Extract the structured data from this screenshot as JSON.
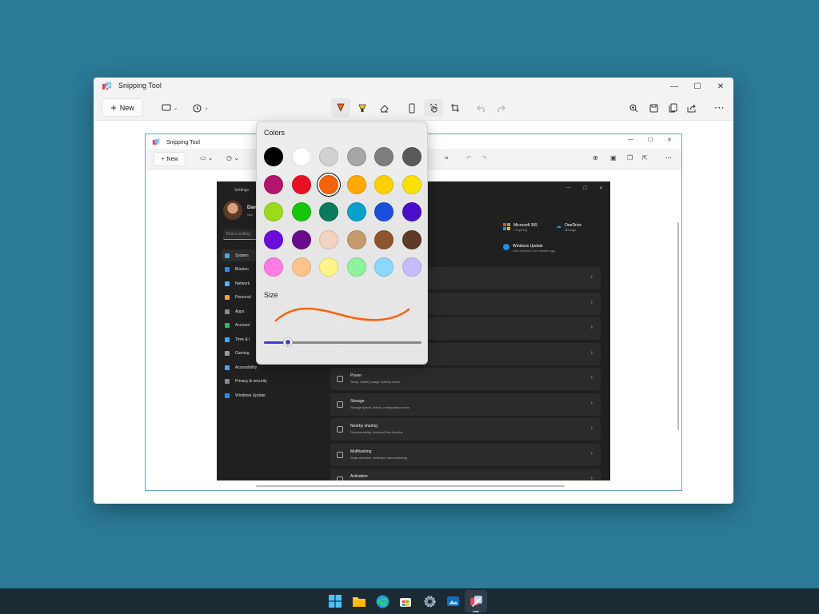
{
  "window": {
    "title": "Snipping Tool",
    "minimize": "—",
    "maximize": "☐",
    "close": "✕"
  },
  "toolbar": {
    "new_label": "New",
    "new_plus": "+",
    "more": "···"
  },
  "flyout": {
    "colors_label": "Colors",
    "size_label": "Size",
    "selected_color": "#f7630c",
    "pen_size_fraction": 0.15,
    "colors": [
      "#000000",
      "#ffffff",
      "#d1d1d1",
      "#a6a6a6",
      "#7e7e7e",
      "#5a5a5a",
      "#b4146c",
      "#e81123",
      "#f7630c",
      "#ffaa00",
      "#ffd000",
      "#fce100",
      "#9bdb1c",
      "#16c60c",
      "#0b7a5b",
      "#0aa0cc",
      "#1a4edb",
      "#4a0fc9",
      "#6a0dd8",
      "#6b0a8a",
      "#f2d3c0",
      "#c59a6d",
      "#8e562e",
      "#5c3a25",
      "#ff7ce5",
      "#ffc38a",
      "#fff48a",
      "#8ff29e",
      "#8ad7ff",
      "#c7bbff"
    ]
  },
  "inner": {
    "title": "Snipping Tool",
    "new_label": "New",
    "settings": {
      "title": "Settings",
      "user_name": "Dav",
      "user_email": "skle",
      "search_placeholder": "Find a setting",
      "nav": [
        {
          "label": "System",
          "color": "#4aa3ff"
        },
        {
          "label": "Bluetoo",
          "color": "#3a86ff"
        },
        {
          "label": "Network",
          "color": "#5ab0ff"
        },
        {
          "label": "Personal",
          "color": "#f0a13a"
        },
        {
          "label": "Apps",
          "color": "#8a8a8a"
        },
        {
          "label": "Account",
          "color": "#2fb86b"
        },
        {
          "label": "Time & l",
          "color": "#4aa3ff"
        },
        {
          "label": "Gaming",
          "color": "#999999"
        },
        {
          "label": "Accessibility",
          "color": "#4aa3ff"
        },
        {
          "label": "Privacy & security",
          "color": "#8a8a8a"
        },
        {
          "label": "Windows Update",
          "color": "#2a8ee0"
        }
      ],
      "tiles": [
        {
          "title": "Microsoft 365",
          "sub": "• Expiring"
        },
        {
          "title": "OneDrive",
          "sub": "Manage"
        },
        {
          "title": "Windows Update",
          "sub": "Last checked: 34 minutes ago"
        }
      ],
      "rows": [
        {
          "title": "",
          "sub": "profile"
        },
        {
          "title": "",
          "sub": "n"
        },
        {
          "title": "",
          "sub": ""
        },
        {
          "title": "",
          "sub": ""
        },
        {
          "title": "Power",
          "sub": "Sleep, battery usage, battery saver"
        },
        {
          "title": "Storage",
          "sub": "Storage space, drives, configuration rules"
        },
        {
          "title": "Nearby sharing",
          "sub": "Discoverability, received files location"
        },
        {
          "title": "Multitasking",
          "sub": "Snap windows, desktops, task switching"
        },
        {
          "title": "Activation",
          "sub": ""
        }
      ]
    }
  },
  "taskbar": {
    "apps": [
      "start-icon",
      "file-explorer-icon",
      "edge-icon",
      "store-icon",
      "settings-icon",
      "photos-icon",
      "snipping-tool-icon"
    ]
  }
}
